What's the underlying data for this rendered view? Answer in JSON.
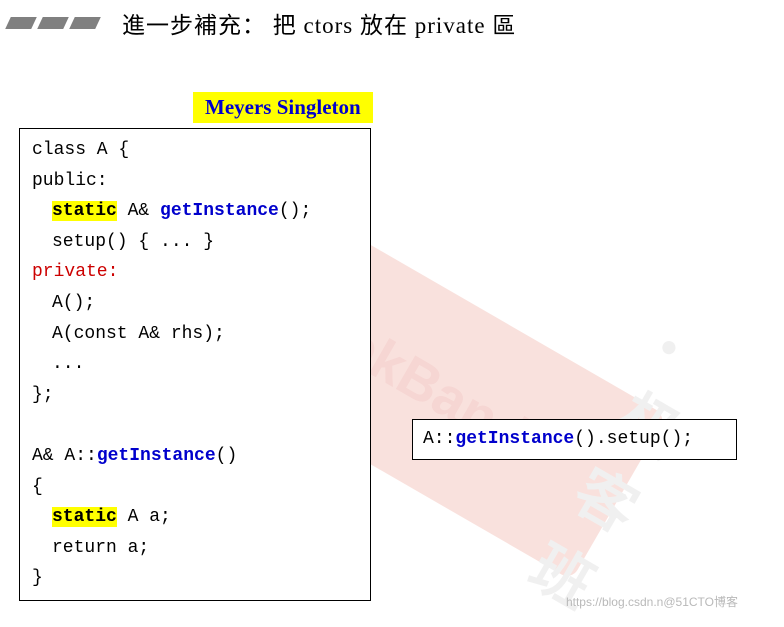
{
  "header": {
    "title_pre": "進一步補充： 把 ",
    "title_mid": "ctors",
    "title_post": " 放在 ",
    "title_kw": "private",
    "title_end": " 區"
  },
  "banner": {
    "text": "Meyers Singleton"
  },
  "code_left": {
    "l01": "class A {",
    "l02": "public:",
    "l03_kw": "static",
    "l03_mid": " A& ",
    "l03_fn": "getInstance",
    "l03_end": "();",
    "l04": "setup() { ... }",
    "l05": "private:",
    "l06": "A();",
    "l07": "A(const A& rhs);",
    "l08": "...",
    "l09": "};",
    "l11_pre": "A& A::",
    "l11_fn": "getInstance",
    "l11_end": "()",
    "l12": "{",
    "l13_kw": "static",
    "l13_end": " A a;",
    "l14": "return a;",
    "l15": "}"
  },
  "code_right": {
    "pre": "A::",
    "fn": "getInstance",
    "end": "().setup();"
  },
  "watermark": {
    "brand": "GeekBand",
    "cn": "极客班"
  },
  "attribution": {
    "text": "https://blog.csdn.n@51CTO博客"
  }
}
